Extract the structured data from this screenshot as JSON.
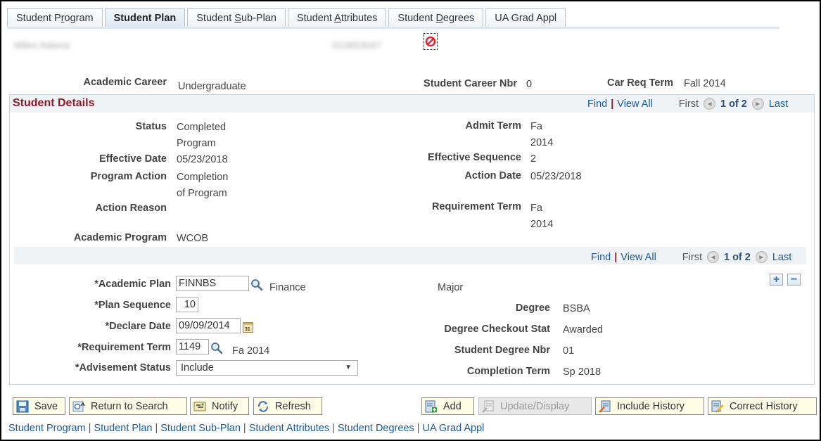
{
  "tabs": [
    {
      "label_pre": "Student P",
      "label_u": "r",
      "label_post": "ogram",
      "active": false
    },
    {
      "label_pre": "Student Plan",
      "label_u": "",
      "label_post": "",
      "active": true
    },
    {
      "label_pre": "Student ",
      "label_u": "S",
      "label_post": "ub-Plan",
      "active": false
    },
    {
      "label_pre": "Student ",
      "label_u": "A",
      "label_post": "ttributes",
      "active": false
    },
    {
      "label_pre": "Student ",
      "label_u": "D",
      "label_post": "egrees",
      "active": false
    },
    {
      "label_pre": "UA Grad Appl",
      "label_u": "",
      "label_post": "",
      "active": false
    }
  ],
  "header": {
    "student_name": "Miles Adams",
    "student_id": "010653047",
    "academic_career_label": "Academic Career",
    "academic_career_value": "Undergraduate",
    "career_nbr_label": "Student Career Nbr",
    "career_nbr_value": "0",
    "car_req_term_label": "Car Req Term",
    "car_req_term_value": "Fall 2014"
  },
  "student_details": {
    "title": "Student Details",
    "nav": {
      "find": "Find",
      "view_all": "View All",
      "first": "First",
      "count": "1 of 2",
      "last": "Last"
    },
    "status_label": "Status",
    "status_value_1": "Completed",
    "status_value_2": "Program",
    "effective_date_label": "Effective Date",
    "effective_date_value": "05/23/2018",
    "program_action_label": "Program Action",
    "program_action_value_1": "Completion",
    "program_action_value_2": "of Program",
    "action_reason_label": "Action Reason",
    "action_reason_value": "",
    "academic_program_label": "Academic Program",
    "academic_program_value": "WCOB",
    "admit_term_label": "Admit Term",
    "admit_term_value_1": "Fa",
    "admit_term_value_2": "2014",
    "effective_sequence_label": "Effective Sequence",
    "effective_sequence_value": "2",
    "action_date_label": "Action Date",
    "action_date_value": "05/23/2018",
    "requirement_term_label": "Requirement Term",
    "requirement_term_value_1": "Fa",
    "requirement_term_value_2": "2014"
  },
  "plan": {
    "nav": {
      "find": "Find",
      "view_all": "View All",
      "first": "First",
      "count": "1 of 2",
      "last": "Last"
    },
    "academic_plan_label": "*Academic Plan",
    "academic_plan_value": "FINNBS",
    "academic_plan_desc": "Finance",
    "plan_type": "Major",
    "plan_sequence_label": "*Plan Sequence",
    "plan_sequence_value": "10",
    "declare_date_label": "*Declare Date",
    "declare_date_value": "09/09/2014",
    "requirement_term_label": "*Requirement Term",
    "requirement_term_value": "1149",
    "requirement_term_desc": "Fa 2014",
    "advisement_status_label": "*Advisement Status",
    "advisement_status_value": "Include",
    "degree_label": "Degree",
    "degree_value": "BSBA",
    "degree_checkout_label": "Degree Checkout Stat",
    "degree_checkout_value": "Awarded",
    "student_degree_nbr_label": "Student Degree Nbr",
    "student_degree_nbr_value": "01",
    "completion_term_label": "Completion Term",
    "completion_term_value": "Sp 2018",
    "add_row": "+",
    "delete_row": "−"
  },
  "toolbar": {
    "save": "Save",
    "return_to_search": "Return to Search",
    "notify": "Notify",
    "refresh": "Refresh",
    "add": "Add",
    "update_display": "Update/Display",
    "include_history": "Include History",
    "correct_history": "Correct History"
  },
  "footer_links": [
    "Student Program",
    "Student Plan",
    "Student Sub-Plan",
    "Student Attributes",
    "Student Degrees",
    "UA Grad Appl"
  ],
  "colors": {
    "section_title": "#8b1a2b",
    "link": "#1a5a9a",
    "button_bg": "#fffce8"
  }
}
